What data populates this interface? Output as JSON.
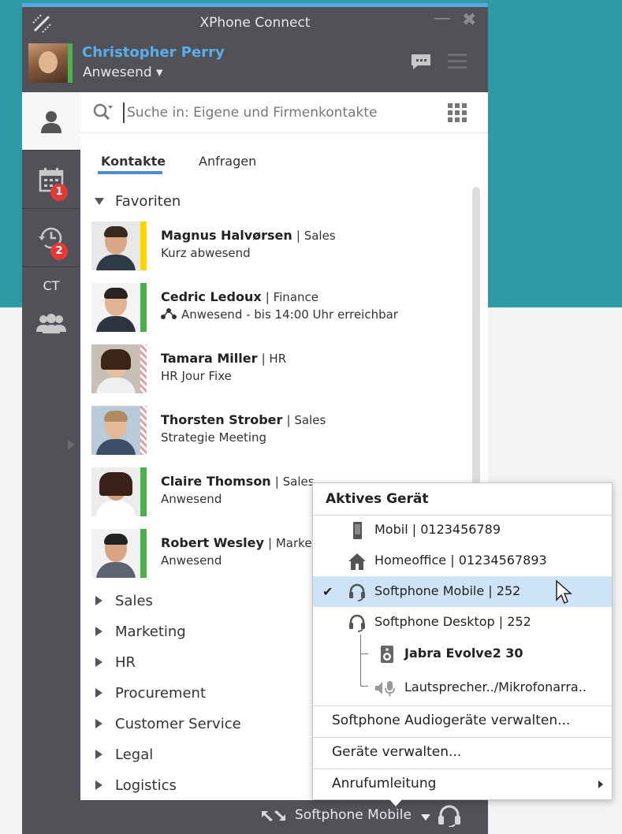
{
  "app": {
    "title": "XPhone Connect",
    "accent_color": "#5aa6e0"
  },
  "user": {
    "name": "Christopher Perry",
    "status": "Anwesend ▾",
    "status_color": "#4caf50"
  },
  "nav": {
    "calendar_badge": "1",
    "history_badge": "2",
    "ct_label": "CT"
  },
  "search": {
    "placeholder": "Suche in: Eigene und Firmenkontakte"
  },
  "tabs": {
    "contacts": "Kontakte",
    "requests": "Anfragen"
  },
  "favorites": {
    "label": "Favoriten",
    "contacts": [
      {
        "name": "Magnus Halvørsen",
        "dept": "| Sales",
        "status": "Kurz abwesend",
        "presence": "away"
      },
      {
        "name": "Cedric Ledoux",
        "dept": "| Finance",
        "status": "Anwesend - bis 14:00 Uhr erreichbar",
        "presence": "available"
      },
      {
        "name": "Tamara Miller",
        "dept": "| HR",
        "status": "HR Jour Fixe",
        "presence": "busy"
      },
      {
        "name": "Thorsten Strober",
        "dept": "| Sales",
        "status": "Strategie Meeting",
        "presence": "busy"
      },
      {
        "name": "Claire Thomson",
        "dept": "| Sales",
        "status": "Anwesend",
        "presence": "available"
      },
      {
        "name": "Robert Wesley",
        "dept": "| Market",
        "status": "Anwesend",
        "presence": "available"
      }
    ]
  },
  "groups": [
    "Sales",
    "Marketing",
    "HR",
    "Procurement",
    "Customer Service",
    "Legal",
    "Logistics"
  ],
  "device_menu": {
    "title": "Aktives Gerät",
    "devices": [
      {
        "label": "Mobil  |  0123456789"
      },
      {
        "label": "Homeoffice  |  01234567893"
      },
      {
        "label": "Softphone Mobile  |  252"
      },
      {
        "label": "Softphone Desktop  |  252"
      }
    ],
    "sub_devices": [
      {
        "label": "Jabra Evolve2 30"
      },
      {
        "label": "Lautsprecher../Mikrofonarra.."
      }
    ],
    "actions": {
      "audio": "Softphone Audiogeräte verwalten...",
      "manage": "Geräte verwalten...",
      "forwarding": "Anrufumleitung"
    }
  },
  "statusbar": {
    "active_device": "Softphone Mobile"
  }
}
